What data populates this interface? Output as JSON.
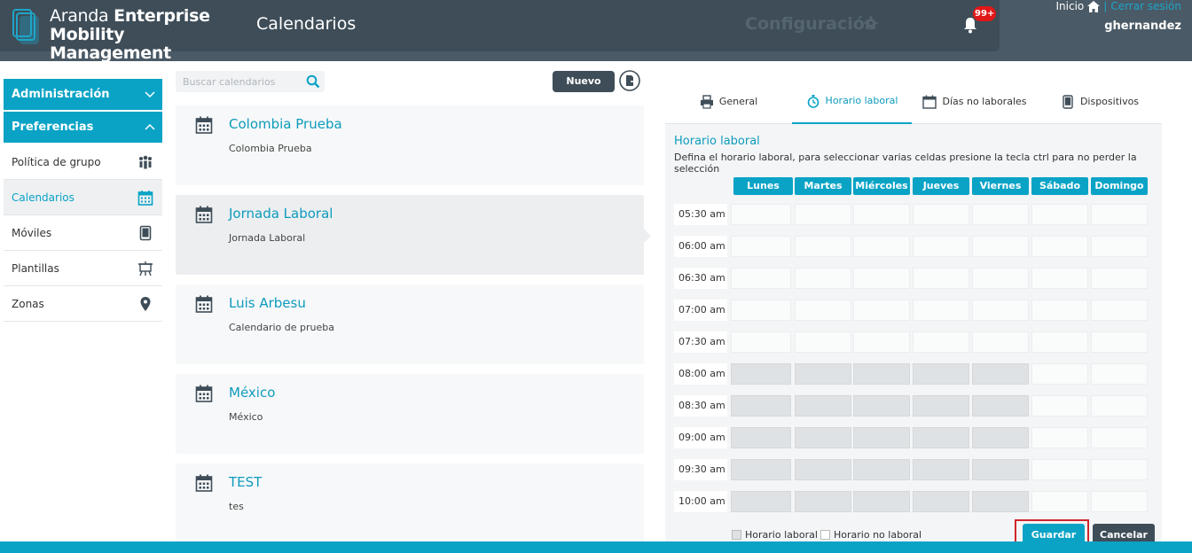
{
  "brand": {
    "light": "Aranda ",
    "bold1": "Enterprise",
    "bold2": "Mobility Management"
  },
  "header": {
    "page_title": "Calendarios",
    "config_label": "Configuración",
    "badge": "99+"
  },
  "user": {
    "home_label": "Inicio",
    "separator": "|",
    "logout_label": "Cerrar sesión",
    "username": "ghernandez"
  },
  "sidebar": {
    "sections": [
      {
        "label": "Administración"
      },
      {
        "label": "Preferencias"
      }
    ],
    "items": [
      {
        "label": "Política de grupo",
        "icon": "group-icon"
      },
      {
        "label": "Calendarios",
        "icon": "calendar-icon"
      },
      {
        "label": "Móviles",
        "icon": "mobile-icon"
      },
      {
        "label": "Plantillas",
        "icon": "template-icon"
      },
      {
        "label": "Zonas",
        "icon": "map-pin-icon"
      }
    ]
  },
  "search": {
    "placeholder": "Buscar calendarios"
  },
  "toolbar": {
    "new_label": "Nuevo"
  },
  "calendars": [
    {
      "title": "Colombia Prueba",
      "desc": "Colombia Prueba"
    },
    {
      "title": "Jornada Laboral",
      "desc": "Jornada Laboral"
    },
    {
      "title": "Luis Arbesu",
      "desc": "Calendario de prueba"
    },
    {
      "title": "México",
      "desc": "México"
    },
    {
      "title": "TEST",
      "desc": "tes"
    }
  ],
  "tabs": [
    {
      "label": "General"
    },
    {
      "label": "Horario laboral"
    },
    {
      "label": "Días no laborales"
    },
    {
      "label": "Dispositivos"
    }
  ],
  "schedule": {
    "title": "Horario laboral",
    "description": "Defina el horario laboral, para seleccionar varias celdas presione la tecla ctrl para no perder la selección",
    "days": [
      "Lunes",
      "Martes",
      "Miércoles",
      "Jueves",
      "Viernes",
      "Sábado",
      "Domingo"
    ],
    "times": [
      "05:30 am",
      "06:00 am",
      "06:30 am",
      "07:00 am",
      "07:30 am",
      "08:00 am",
      "08:30 am",
      "09:00 am",
      "09:30 am",
      "10:00 am"
    ],
    "working_rows": [
      5,
      6,
      7,
      8,
      9
    ],
    "working_days": [
      0,
      1,
      2,
      3,
      4
    ],
    "legend_working": "Horario laboral",
    "legend_nonworking": "Horario no laboral"
  },
  "actions": {
    "save_label": "Guardar",
    "cancel_label": "Cancelar"
  },
  "colors": {
    "accent": "#0aa3c6",
    "header": "#3e4d58",
    "working_cell": "#dfe2e4",
    "highlight": "#d0262d"
  }
}
